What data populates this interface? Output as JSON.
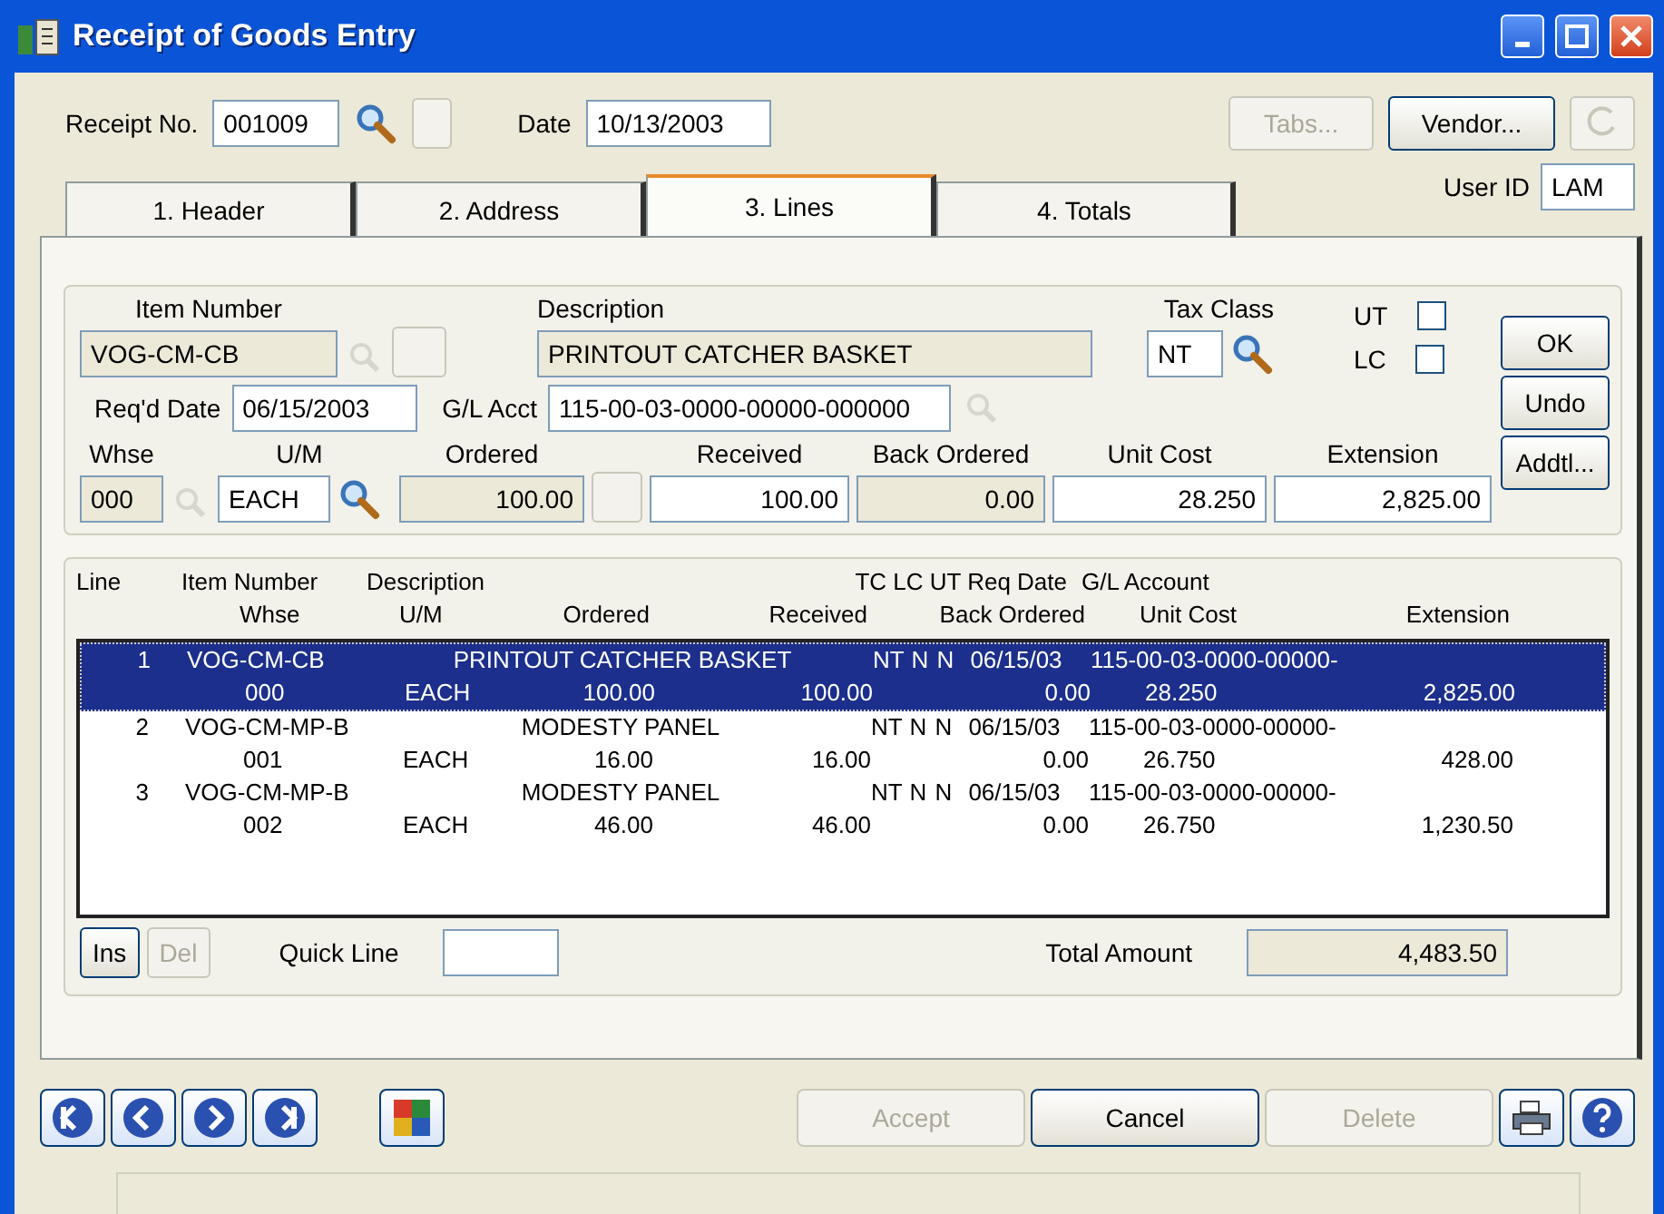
{
  "window": {
    "title": "Receipt of Goods Entry"
  },
  "header": {
    "receipt_label": "Receipt No.",
    "receipt_no": "001009",
    "date_label": "Date",
    "date": "10/13/2003",
    "user_id_label": "User ID",
    "user_id": "LAM",
    "buttons": [
      {
        "label": "Tabs...",
        "disabled": true
      },
      {
        "label": "Vendor...",
        "disabled": false
      }
    ]
  },
  "tabs": [
    {
      "label": "1. Header",
      "selected": false
    },
    {
      "label": "2. Address",
      "selected": false
    },
    {
      "label": "3. Lines",
      "selected": true
    },
    {
      "label": "4. Totals",
      "selected": false
    }
  ],
  "entry": {
    "item_number": {
      "label": "Item Number",
      "value": "VOG-CM-CB",
      "disabled": true
    },
    "description": {
      "label": "Description",
      "value": "PRINTOUT CATCHER BASKET",
      "disabled": true
    },
    "tax_class": {
      "label": "Tax Class",
      "value": "NT",
      "disabled": false
    },
    "ut": {
      "label": "UT",
      "checked": false
    },
    "lc": {
      "label": "LC",
      "checked": false
    },
    "reqd_date": {
      "label": "Req'd Date",
      "value": "06/15/2003",
      "disabled": false
    },
    "gl_acct": {
      "label": "G/L Acct",
      "value": "115-00-03-0000-00000-000000",
      "disabled": false
    },
    "whse": {
      "label": "Whse",
      "value": "000",
      "disabled": true
    },
    "um": {
      "label": "U/M",
      "value": "EACH",
      "disabled": false
    },
    "ordered": {
      "label": "Ordered",
      "value": "100.00",
      "disabled": true
    },
    "received": {
      "label": "Received",
      "value": "100.00",
      "disabled": false
    },
    "back_ordered": {
      "label": "Back Ordered",
      "value": "0.00",
      "disabled": true
    },
    "unit_cost": {
      "label": "Unit Cost",
      "value": "28.250",
      "disabled": false
    },
    "extension": {
      "label": "Extension",
      "value": "2,825.00",
      "disabled": false
    },
    "buttons": [
      "OK",
      "Undo",
      "Addtl..."
    ]
  },
  "lines": {
    "columns_line1": [
      "Line",
      "Item Number",
      "Description",
      "TC LC UT Req Date",
      "G/L Account"
    ],
    "columns_line2": [
      "Whse",
      "U/M",
      "Ordered",
      "Received",
      "Back Ordered",
      "Unit Cost",
      "Extension"
    ],
    "rows": [
      {
        "line": "1",
        "item": "VOG-CM-CB",
        "description": "PRINTOUT CATCHER BASKET",
        "tc": "NT",
        "lc": "N",
        "ut": "N",
        "date": "06/15/03",
        "gl": "115-00-03-0000-00000-",
        "whse": "000",
        "um": "EACH",
        "ordered": "100.00",
        "received": "100.00",
        "back_ordered": "0.00",
        "unit_cost": "28.250",
        "extension": "2,825.00",
        "selected": true
      },
      {
        "line": "2",
        "item": "VOG-CM-MP-B",
        "description": "MODESTY PANEL",
        "tc": "NT",
        "lc": "N",
        "ut": "N",
        "date": "06/15/03",
        "gl": "115-00-03-0000-00000-",
        "whse": "001",
        "um": "EACH",
        "ordered": "16.00",
        "received": "16.00",
        "back_ordered": "0.00",
        "unit_cost": "26.750",
        "extension": "428.00",
        "selected": false
      },
      {
        "line": "3",
        "item": "VOG-CM-MP-B",
        "description": "MODESTY PANEL",
        "tc": "NT",
        "lc": "N",
        "ut": "N",
        "date": "06/15/03",
        "gl": "115-00-03-0000-00000-",
        "whse": "002",
        "um": "EACH",
        "ordered": "46.00",
        "received": "46.00",
        "back_ordered": "0.00",
        "unit_cost": "26.750",
        "extension": "1,230.50",
        "selected": false
      }
    ]
  },
  "footer": {
    "buttons": [
      {
        "label": "Ins",
        "disabled": false
      },
      {
        "label": "Del",
        "disabled": true
      }
    ],
    "quick_line_label": "Quick Line",
    "total_label": "Total Amount",
    "total": "4,483.50"
  },
  "actions": [
    {
      "label": "Accept",
      "disabled": true
    },
    {
      "label": "Cancel",
      "disabled": false
    },
    {
      "label": "Delete",
      "disabled": true
    }
  ]
}
